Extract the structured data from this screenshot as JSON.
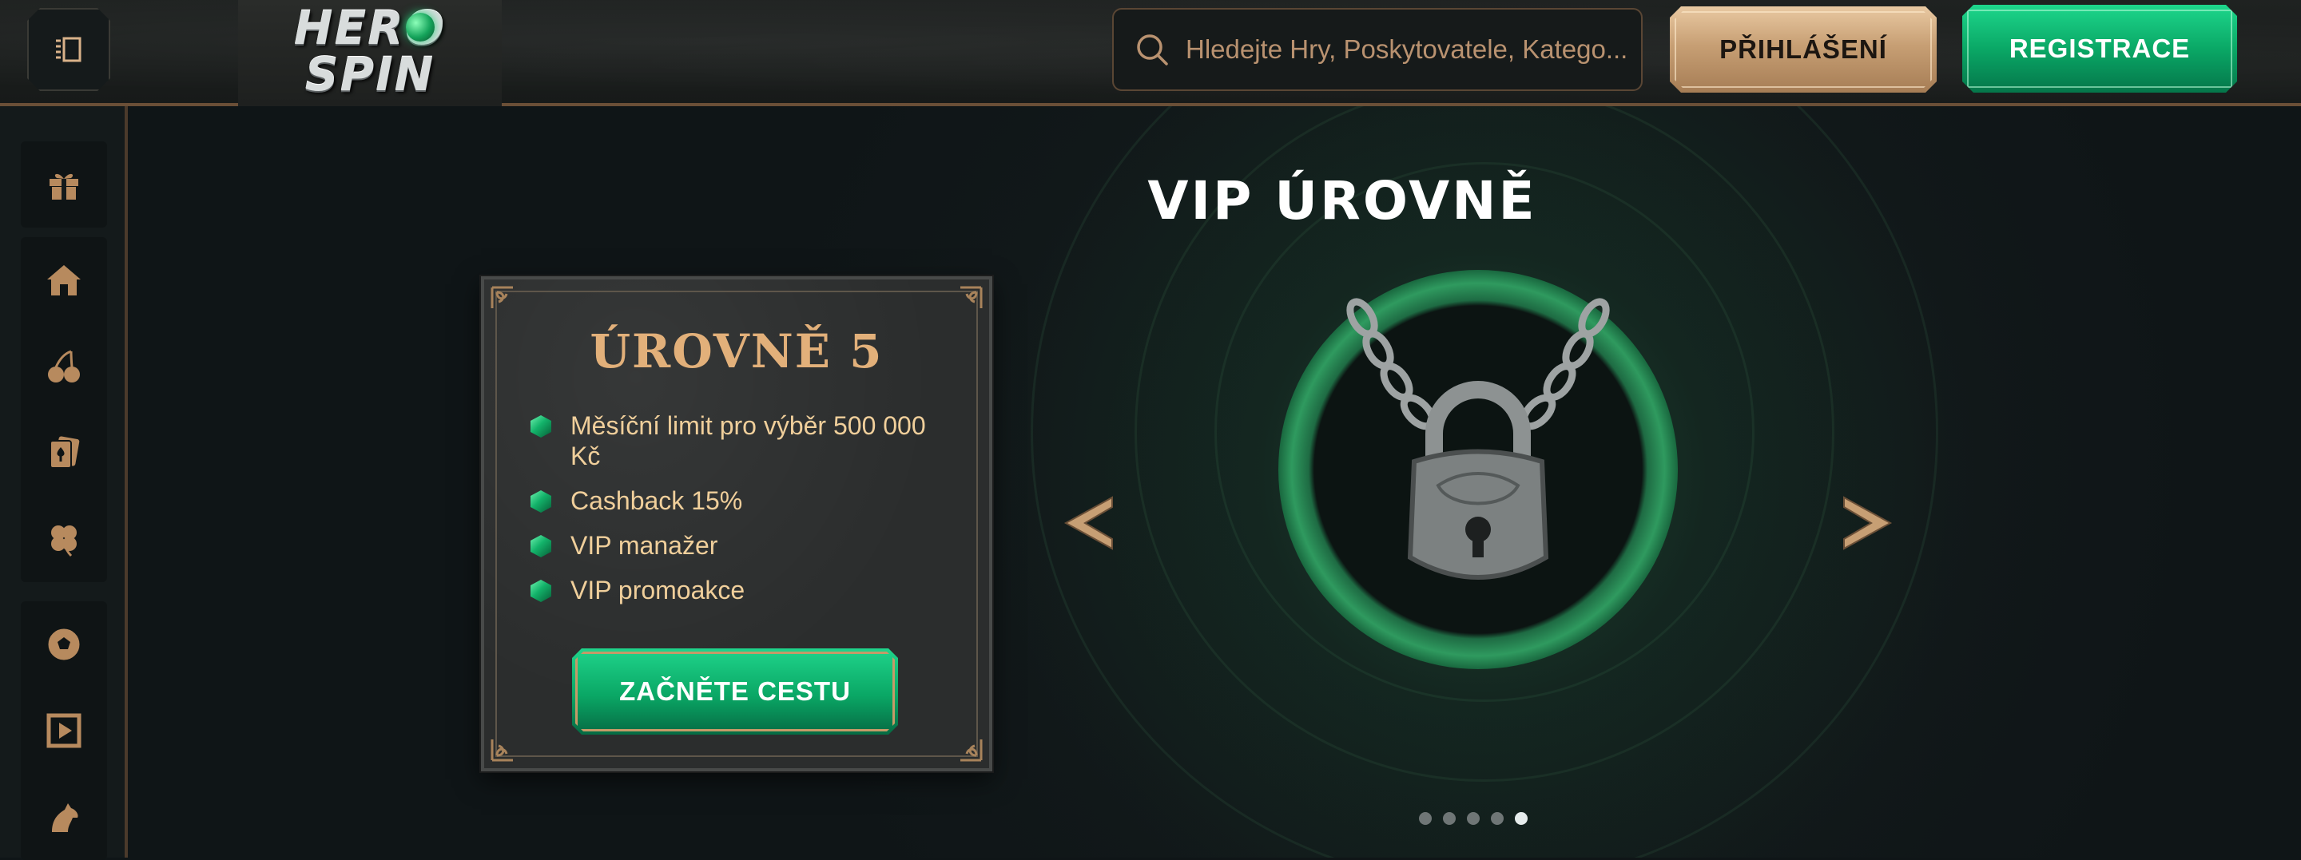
{
  "header": {
    "logo": {
      "line1": "HERO",
      "line2": "SPIN"
    },
    "search": {
      "placeholder": "Hledejte Hry, Poskytovatele, Katego..."
    },
    "login_label": "PŘIHLÁŠENÍ",
    "register_label": "REGISTRACE"
  },
  "sidebar": {
    "items": [
      {
        "icon": "gift-icon"
      },
      {
        "icon": "home-icon"
      },
      {
        "icon": "cherries-icon"
      },
      {
        "icon": "cards-icon"
      },
      {
        "icon": "clover-icon"
      },
      {
        "icon": "soccer-ball-icon"
      },
      {
        "icon": "live-video-icon"
      },
      {
        "icon": "horse-icon"
      }
    ]
  },
  "hero": {
    "title": "VIP ÚROVNĚ",
    "card": {
      "title": "ÚROVNĚ 5",
      "benefits": [
        "Měsíční limit pro výběr 500 000 Kč",
        "Cashback 15%",
        "VIP manažer",
        "VIP promoakce"
      ],
      "cta_label": "ZAČNĚTE CESTU"
    },
    "carousel": {
      "slide_count": 5,
      "active_index": 4
    }
  },
  "colors": {
    "accent_gold": "#e2b07a",
    "accent_green": "#0aa866",
    "background": "#0f1517"
  }
}
